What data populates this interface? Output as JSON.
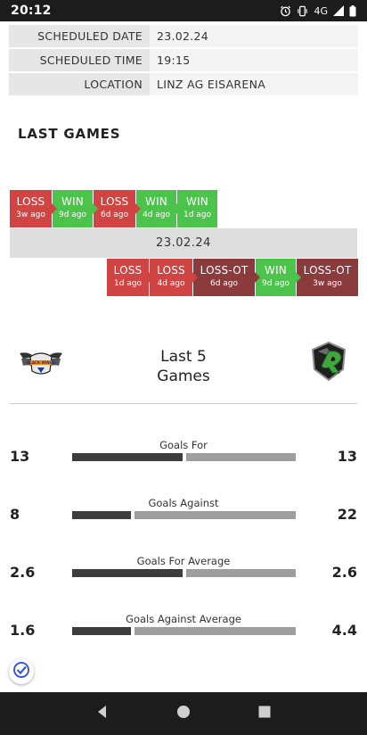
{
  "status_bar": {
    "time": "20:12",
    "network": "4G"
  },
  "info": [
    {
      "label": "SCHEDULED DATE",
      "value": "23.02.24"
    },
    {
      "label": "SCHEDULED TIME",
      "value": "19:15"
    },
    {
      "label": "LOCATION",
      "value": "LINZ AG EISARENA"
    }
  ],
  "last_games_title": "LAST GAMES",
  "home_results": [
    {
      "result": "LOSS",
      "ago": "3w ago",
      "type": "loss"
    },
    {
      "result": "WIN",
      "ago": "9d ago",
      "type": "win"
    },
    {
      "result": "LOSS",
      "ago": "6d ago",
      "type": "loss"
    },
    {
      "result": "WIN",
      "ago": "4d ago",
      "type": "win"
    },
    {
      "result": "WIN",
      "ago": "1d ago",
      "type": "win"
    }
  ],
  "match_date": "23.02.24",
  "away_results": [
    {
      "result": "LOSS",
      "ago": "1d ago",
      "type": "loss"
    },
    {
      "result": "LOSS",
      "ago": "4d ago",
      "type": "loss"
    },
    {
      "result": "LOSS-OT",
      "ago": "6d ago",
      "type": "loss-ot"
    },
    {
      "result": "WIN",
      "ago": "9d ago",
      "type": "win"
    },
    {
      "result": "LOSS-OT",
      "ago": "3w ago",
      "type": "loss-ot"
    }
  ],
  "compare": {
    "title_line1": "Last 5",
    "title_line2": "Games"
  },
  "stats": [
    {
      "label": "Goals For",
      "home": "13",
      "away": "13",
      "home_value": 13,
      "away_value": 13
    },
    {
      "label": "Goals Against",
      "home": "8",
      "away": "22",
      "home_value": 8,
      "away_value": 22
    },
    {
      "label": "Goals For Average",
      "home": "2.6",
      "away": "2.6",
      "home_value": 2.6,
      "away_value": 2.6
    },
    {
      "label": "Goals Against Average",
      "home": "1.6",
      "away": "4.4",
      "home_value": 1.6,
      "away_value": 4.4
    }
  ],
  "colors": {
    "win": "#4cc34a",
    "loss": "#d14444",
    "loss_ot": "#8b3b3b",
    "home_bar": "#3d3d3d",
    "away_bar": "#9e9e9e"
  },
  "icons": [
    "alarm-icon",
    "vibrate-icon",
    "signal-icon",
    "battery-icon",
    "verified-check-icon",
    "back-icon",
    "home-icon",
    "recents-icon"
  ]
}
